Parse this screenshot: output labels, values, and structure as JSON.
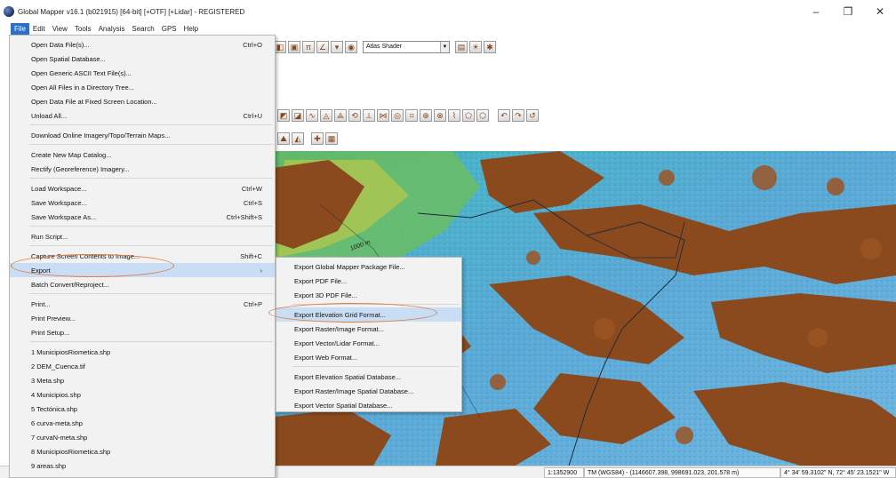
{
  "window": {
    "title": "Global Mapper v16.1 (b021915) [64-bit] [+OTF] [+Lidar] - REGISTERED",
    "minimize": "–",
    "restore": "❐",
    "close": "✕"
  },
  "menubar": [
    "File",
    "Edit",
    "View",
    "Tools",
    "Analysis",
    "Search",
    "GPS",
    "Help"
  ],
  "toolbar": {
    "shader_value": "Atlas Shader"
  },
  "file_menu": [
    {
      "label": "Open Data File(s)...",
      "shortcut": "Ctrl+O"
    },
    {
      "label": "Open Spatial Database...",
      "shortcut": ""
    },
    {
      "label": "Open Generic ASCII Text File(s)...",
      "shortcut": ""
    },
    {
      "label": "Open All Files in a Directory Tree...",
      "shortcut": ""
    },
    {
      "label": "Open Data File at Fixed Screen Location...",
      "shortcut": ""
    },
    {
      "label": "Unload All...",
      "shortcut": "Ctrl+U"
    },
    {
      "label": "Download Online Imagery/Topo/Terrain Maps...",
      "shortcut": ""
    },
    {
      "label": "Create New Map Catalog...",
      "shortcut": ""
    },
    {
      "label": "Rectify (Georeference) Imagery...",
      "shortcut": ""
    },
    {
      "label": "Load Workspace...",
      "shortcut": "Ctrl+W"
    },
    {
      "label": "Save Workspace...",
      "shortcut": "Ctrl+S"
    },
    {
      "label": "Save Workspace As...",
      "shortcut": "Ctrl+Shift+S"
    },
    {
      "label": "Run Script...",
      "shortcut": ""
    },
    {
      "label": "Capture Screen Contents to Image...",
      "shortcut": "Shift+C"
    },
    {
      "label": "Export",
      "shortcut": "›"
    },
    {
      "label": "Batch Convert/Reproject...",
      "shortcut": ""
    },
    {
      "label": "Print...",
      "shortcut": "Ctrl+P"
    },
    {
      "label": "Print Preview...",
      "shortcut": ""
    },
    {
      "label": "Print Setup...",
      "shortcut": ""
    },
    {
      "label": "1 MunicipiosRiometica.shp",
      "shortcut": ""
    },
    {
      "label": "2 DEM_Cuenca.tif",
      "shortcut": ""
    },
    {
      "label": "3 Meta.shp",
      "shortcut": ""
    },
    {
      "label": "4 Municipios.shp",
      "shortcut": ""
    },
    {
      "label": "5 Tectónica.shp",
      "shortcut": ""
    },
    {
      "label": "6 curva-meta.shp",
      "shortcut": ""
    },
    {
      "label": "7 curvaN-meta.shp",
      "shortcut": ""
    },
    {
      "label": "8 MunicipiosRiometica.shp",
      "shortcut": ""
    },
    {
      "label": "9 areas.shp",
      "shortcut": ""
    }
  ],
  "export_submenu": [
    "Export Global Mapper Package File...",
    "Export PDF File...",
    "Export 3D PDF File...",
    "Export Elevation Grid Format...",
    "Export Raster/Image Format...",
    "Export Vector/Lidar Format...",
    "Export Web Format...",
    "Export Elevation Spatial Database...",
    "Export Raster/Image Spatial Database...",
    "Export Vector Spatial Database..."
  ],
  "map": {
    "contour_label": "1000 m"
  },
  "statusbar": {
    "scale": "1:1352900",
    "projection": "TM (WGS84) - (1146607.398, 998691.023, 201.578 m)",
    "coords": "4° 34' 59.3102\" N, 72° 45' 23.1521\" W"
  },
  "colors": {
    "highlight": "#c9def5",
    "annotation": "#e07a3c",
    "terrain_low": "#5aa9d0",
    "terrain_high": "#8a4a1e"
  }
}
